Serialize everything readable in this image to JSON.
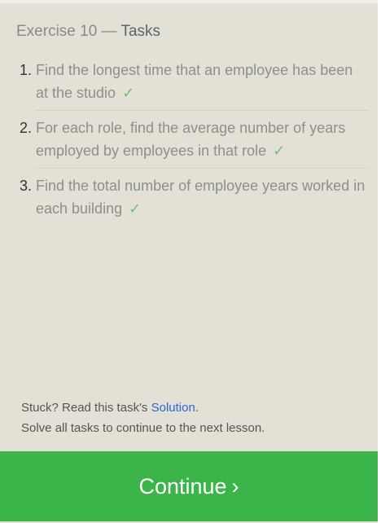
{
  "header": {
    "exercise": "Exercise 10 —",
    "tasks_label": "Tasks"
  },
  "tasks": [
    {
      "number": "1.",
      "text": "Find the longest time that an employee has been at the studio",
      "check": "✓"
    },
    {
      "number": "2.",
      "text": "For each role, find the average number of years employed by employees in that role",
      "check": "✓"
    },
    {
      "number": "3.",
      "text": "Find the total number of employee years worked in each building",
      "check": "✓"
    }
  ],
  "footer": {
    "stuck_prefix": "Stuck? Read this task's ",
    "solution_link": "Solution",
    "stuck_suffix": ".",
    "hint": "Solve all tasks to continue to the next lesson."
  },
  "continue_button": {
    "label": "Continue",
    "chevron": "›"
  },
  "colors": {
    "panel_bg": "#e3e0d5",
    "check": "#6cc36c",
    "link": "#2a67d8",
    "continue_bg": "#3bb44a"
  }
}
